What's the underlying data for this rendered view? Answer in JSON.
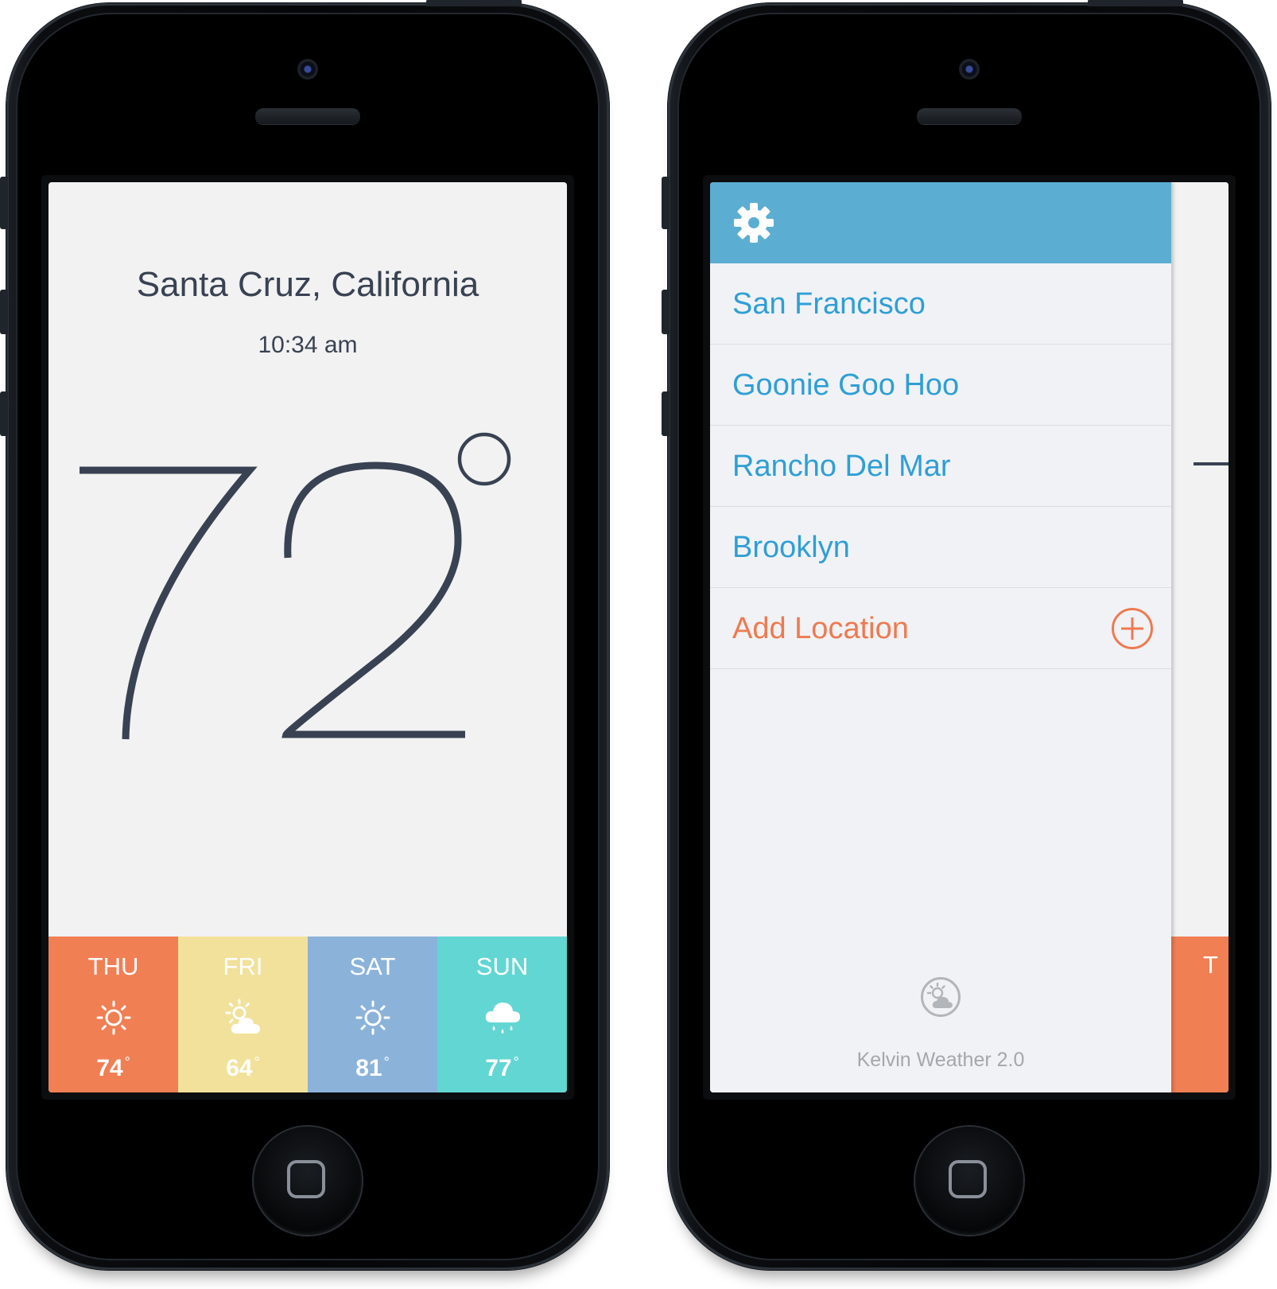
{
  "left_phone": {
    "city": "Santa Cruz, California",
    "time": "10:34 am",
    "temperature": "72",
    "forecast": [
      {
        "day": "THU",
        "temp": "74",
        "icon": "sun-icon",
        "color": "#f07f54"
      },
      {
        "day": "FRI",
        "temp": "64",
        "icon": "partly-cloudy-icon",
        "color": "#f2e19a"
      },
      {
        "day": "SAT",
        "temp": "81",
        "icon": "sun-icon",
        "color": "#8bb3da"
      },
      {
        "day": "SUN",
        "temp": "77",
        "icon": "rain-cloud-icon",
        "color": "#62d6d3"
      }
    ]
  },
  "right_phone": {
    "locations": [
      "San Francisco",
      "Goonie Goo Hoo",
      "Rancho Del Mar",
      "Brooklyn"
    ],
    "add_location": "Add Location",
    "app_version": "Kelvin Weather 2.0",
    "peek_day": "T",
    "colors": {
      "header": "#5cadd2",
      "location_text": "#2e9fd6",
      "add_text": "#ee7a50"
    }
  },
  "degree_symbol": "°"
}
